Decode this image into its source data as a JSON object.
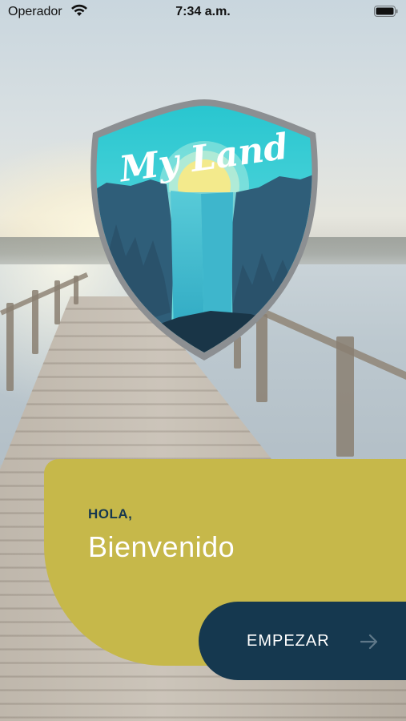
{
  "status_bar": {
    "carrier": "Operador",
    "time": "7:34 a.m."
  },
  "logo": {
    "text": "My Land",
    "icon": "my-land-shield-logo"
  },
  "welcome_card": {
    "greeting": "HOLA,",
    "title": "Bienvenido"
  },
  "start_button": {
    "label": "EMPEZAR",
    "icon": "arrow-right-icon"
  },
  "colors": {
    "card": "#c6b84a",
    "button": "#15384f",
    "greeting_text": "#17384f",
    "title_text": "#ffffff"
  }
}
